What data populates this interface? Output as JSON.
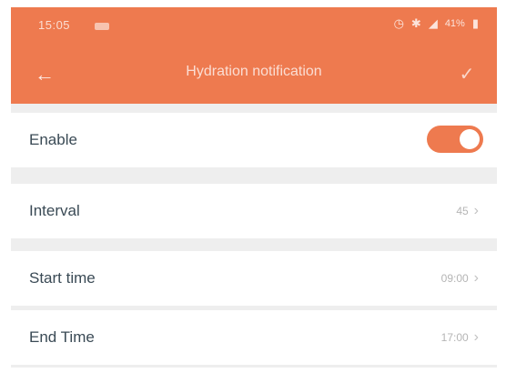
{
  "status_bar": {
    "time": "15:05",
    "icons": [
      "alarm-icon",
      "bluetooth-icon",
      "signal-icon",
      "battery-icon"
    ],
    "battery": "41%"
  },
  "header": {
    "title": "Hydration notification",
    "back_icon": "back-arrow-icon",
    "confirm_icon": "checkmark-icon",
    "color": "#ee7a4f"
  },
  "settings": {
    "enable": {
      "label": "Enable",
      "on": true
    },
    "interval": {
      "label": "Interval",
      "value": "45"
    },
    "start_time": {
      "label": "Start time",
      "value": "09:00"
    },
    "end_time": {
      "label": "End Time",
      "value": "17:00"
    }
  },
  "colors": {
    "accent": "#ee7a4f",
    "background": "#eeeeee",
    "label_text": "#3a4a55",
    "value_text": "#b5b5b5"
  }
}
